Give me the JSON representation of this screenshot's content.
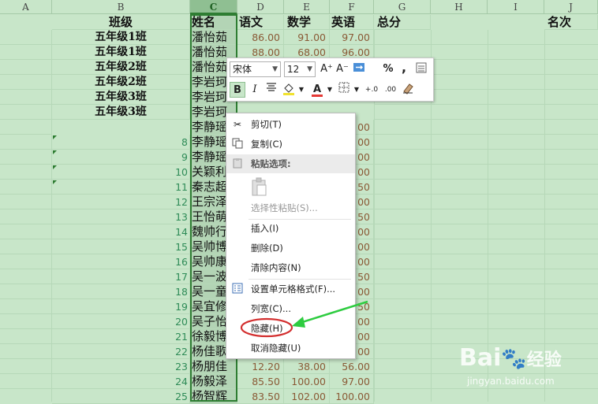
{
  "columns": [
    "A",
    "B",
    "C",
    "D",
    "E",
    "F",
    "G",
    "H",
    "I",
    "J"
  ],
  "headers": {
    "class": "班级",
    "name": "姓名",
    "chinese": "语文",
    "math": "数学",
    "english": "英语",
    "total": "总分",
    "rank": "名次"
  },
  "classes": [
    "五年级1班",
    "五年级1班",
    "五年级2班",
    "五年级2班",
    "五年级3班",
    "五年级3班"
  ],
  "row_numbers": [
    "8",
    "9",
    "10",
    "11",
    "12",
    "13",
    "14",
    "15",
    "16",
    "17",
    "18",
    "19",
    "20",
    "21",
    "22",
    "23",
    "24",
    "25"
  ],
  "names": [
    "潘怡茹",
    "潘怡茹",
    "潘怡茹",
    "李岩珂",
    "李岩珂",
    "李岩珂",
    "李静瑶",
    "李静瑶",
    "李静瑶",
    "关颖利",
    "秦志超",
    "王宗泽",
    "王怡萌",
    "魏帅行",
    "吴帅博",
    "吴帅康",
    "吴一波",
    "吴一童",
    "吴宜修",
    "吴子怡",
    "徐毅博",
    "杨佳歌",
    "杨朋佳",
    "杨毅泽",
    "杨智辉"
  ],
  "scores": {
    "r2": [
      "86.00",
      "91.00",
      "97.00"
    ],
    "r3": [
      "88.00",
      "68.00",
      "96.00"
    ],
    "r23": [
      "12.20",
      "38.00",
      "56.00"
    ],
    "r24": [
      "85.50",
      "100.00",
      "97.00"
    ],
    "r25": [
      "83.50",
      "102.00",
      "100.00"
    ]
  },
  "score_partials": {
    "r7": "00",
    "r8": "00",
    "r9": "00",
    "r10": "00",
    "r11": "50",
    "r12": "00",
    "r13": "50",
    "r14": "00",
    "r15": "00",
    "r16": "00",
    "r17": "50",
    "r18": "00",
    "r19": "50",
    "r20": "00",
    "r21": "00",
    "r22": "00"
  },
  "toolbar": {
    "font_name": "宋体",
    "font_size": "12",
    "grow_label": "A⁺",
    "shrink_label": "A⁻",
    "percent_label": "%",
    "comma_label": ",",
    "bold_label": "B",
    "italic_label": "I",
    "font_color_label": "A",
    "inc_decimal_label": "+.0",
    "dec_decimal_label": ".00"
  },
  "context_menu": {
    "cut": "剪切(T)",
    "copy": "复制(C)",
    "paste_options": "粘贴选项:",
    "paste_special": "选择性粘贴(S)...",
    "insert": "插入(I)",
    "delete": "删除(D)",
    "clear_contents": "清除内容(N)",
    "format_cells": "设置单元格格式(F)...",
    "column_width": "列宽(C)...",
    "hide": "隐藏(H)",
    "unhide": "取消隐藏(U)"
  },
  "watermark": {
    "brand": "Bai",
    "brand_suffix": "经验",
    "url": "jingyan.baidu.com"
  },
  "colors": {
    "sheet_bg": "#c8e6c9",
    "selected_column": "#b3d4b5",
    "highlight_circle": "#d32f2f",
    "arrow": "#2ecc40"
  }
}
